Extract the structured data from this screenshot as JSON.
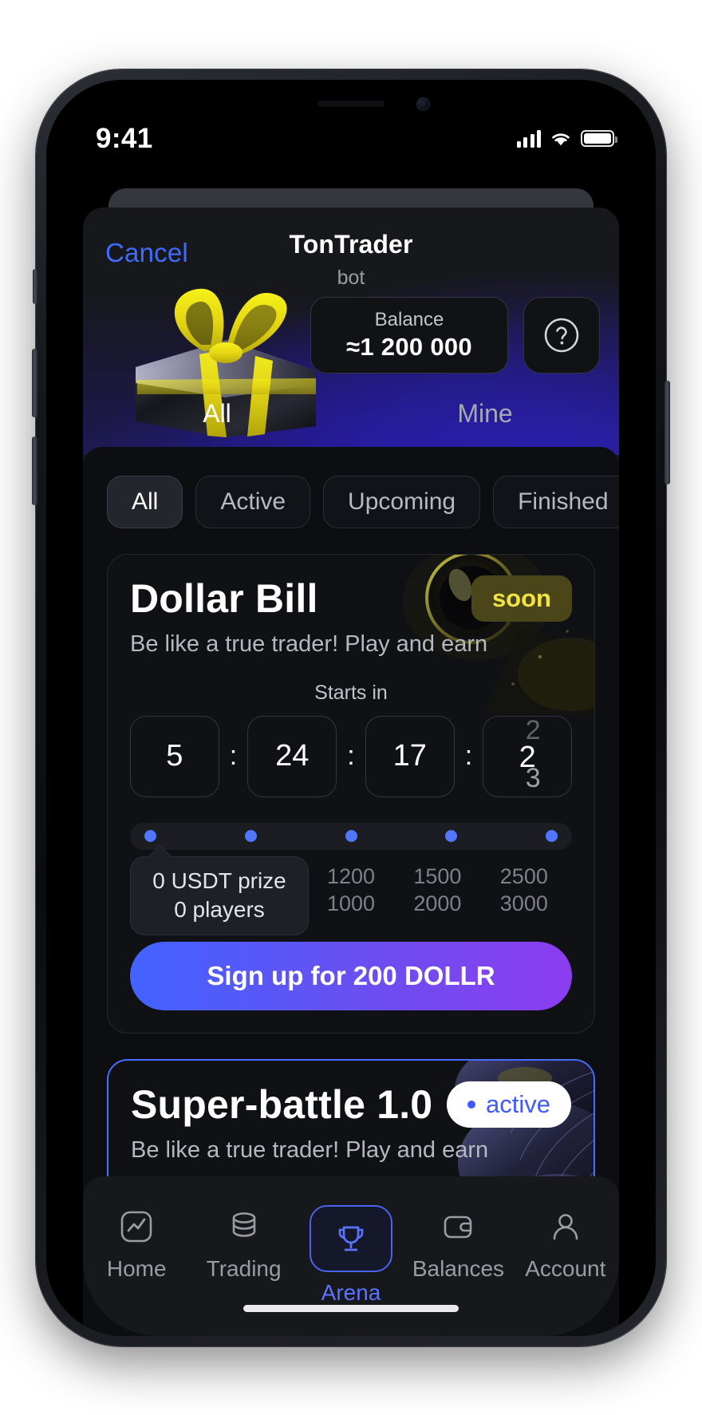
{
  "status_bar": {
    "time": "9:41",
    "signal_icon": "cellular-bars-icon",
    "wifi_icon": "wifi-icon",
    "battery_icon": "battery-full-icon"
  },
  "header": {
    "cancel_label": "Cancel",
    "title": "TonTrader",
    "subtitle": "bot",
    "hero_image_name": "gift-box-image",
    "balance_label": "Balance",
    "balance_value": "≈1 200 000",
    "help_icon": "question-circle-icon"
  },
  "tabs": [
    {
      "label": "All",
      "active": true
    },
    {
      "label": "Mine",
      "active": false
    }
  ],
  "filters": [
    {
      "label": "All",
      "selected": true
    },
    {
      "label": "Active",
      "selected": false
    },
    {
      "label": "Upcoming",
      "selected": false
    },
    {
      "label": "Finished",
      "selected": false
    }
  ],
  "tournaments": [
    {
      "title": "Dollar Bill",
      "badge": "soon",
      "badge_type": "soon",
      "subtitle": "Be like a true trader! Play and earn",
      "starts_in_label": "Starts in",
      "countdown": {
        "days": "5",
        "hours": "24",
        "minutes": "17",
        "seconds": "2",
        "seconds_prev": "2",
        "seconds_next": "3",
        "separator": ":"
      },
      "progress": {
        "dots": 5,
        "tooltip_line1": "0 USDT prize",
        "tooltip_line2": "0 players",
        "tiers": [
          {
            "top": "1200",
            "bottom": "1000"
          },
          {
            "top": "1500",
            "bottom": "2000"
          },
          {
            "top": "2500",
            "bottom": "3000"
          }
        ]
      },
      "cta_label": "Sign up for 200 DOLLR"
    },
    {
      "title": "Super-battle 1.0",
      "badge": "active",
      "badge_type": "active",
      "subtitle": "Be like a true trader! Play and earn"
    }
  ],
  "bottom_nav": [
    {
      "label": "Home",
      "icon": "chart-line-icon",
      "selected": false
    },
    {
      "label": "Trading",
      "icon": "coins-stack-icon",
      "selected": false
    },
    {
      "label": "Arena",
      "icon": "trophy-icon",
      "selected": true
    },
    {
      "label": "Balances",
      "icon": "wallet-icon",
      "selected": false
    },
    {
      "label": "Account",
      "icon": "user-icon",
      "selected": false
    }
  ],
  "colors": {
    "accent_blue": "#4f7bff",
    "badge_soon_bg": "#4a4619",
    "badge_soon_text": "#f2e33f",
    "cta_gradient_start": "#4263ff",
    "cta_gradient_end": "#8b3df0",
    "panel_bg": "#0d0e11"
  }
}
